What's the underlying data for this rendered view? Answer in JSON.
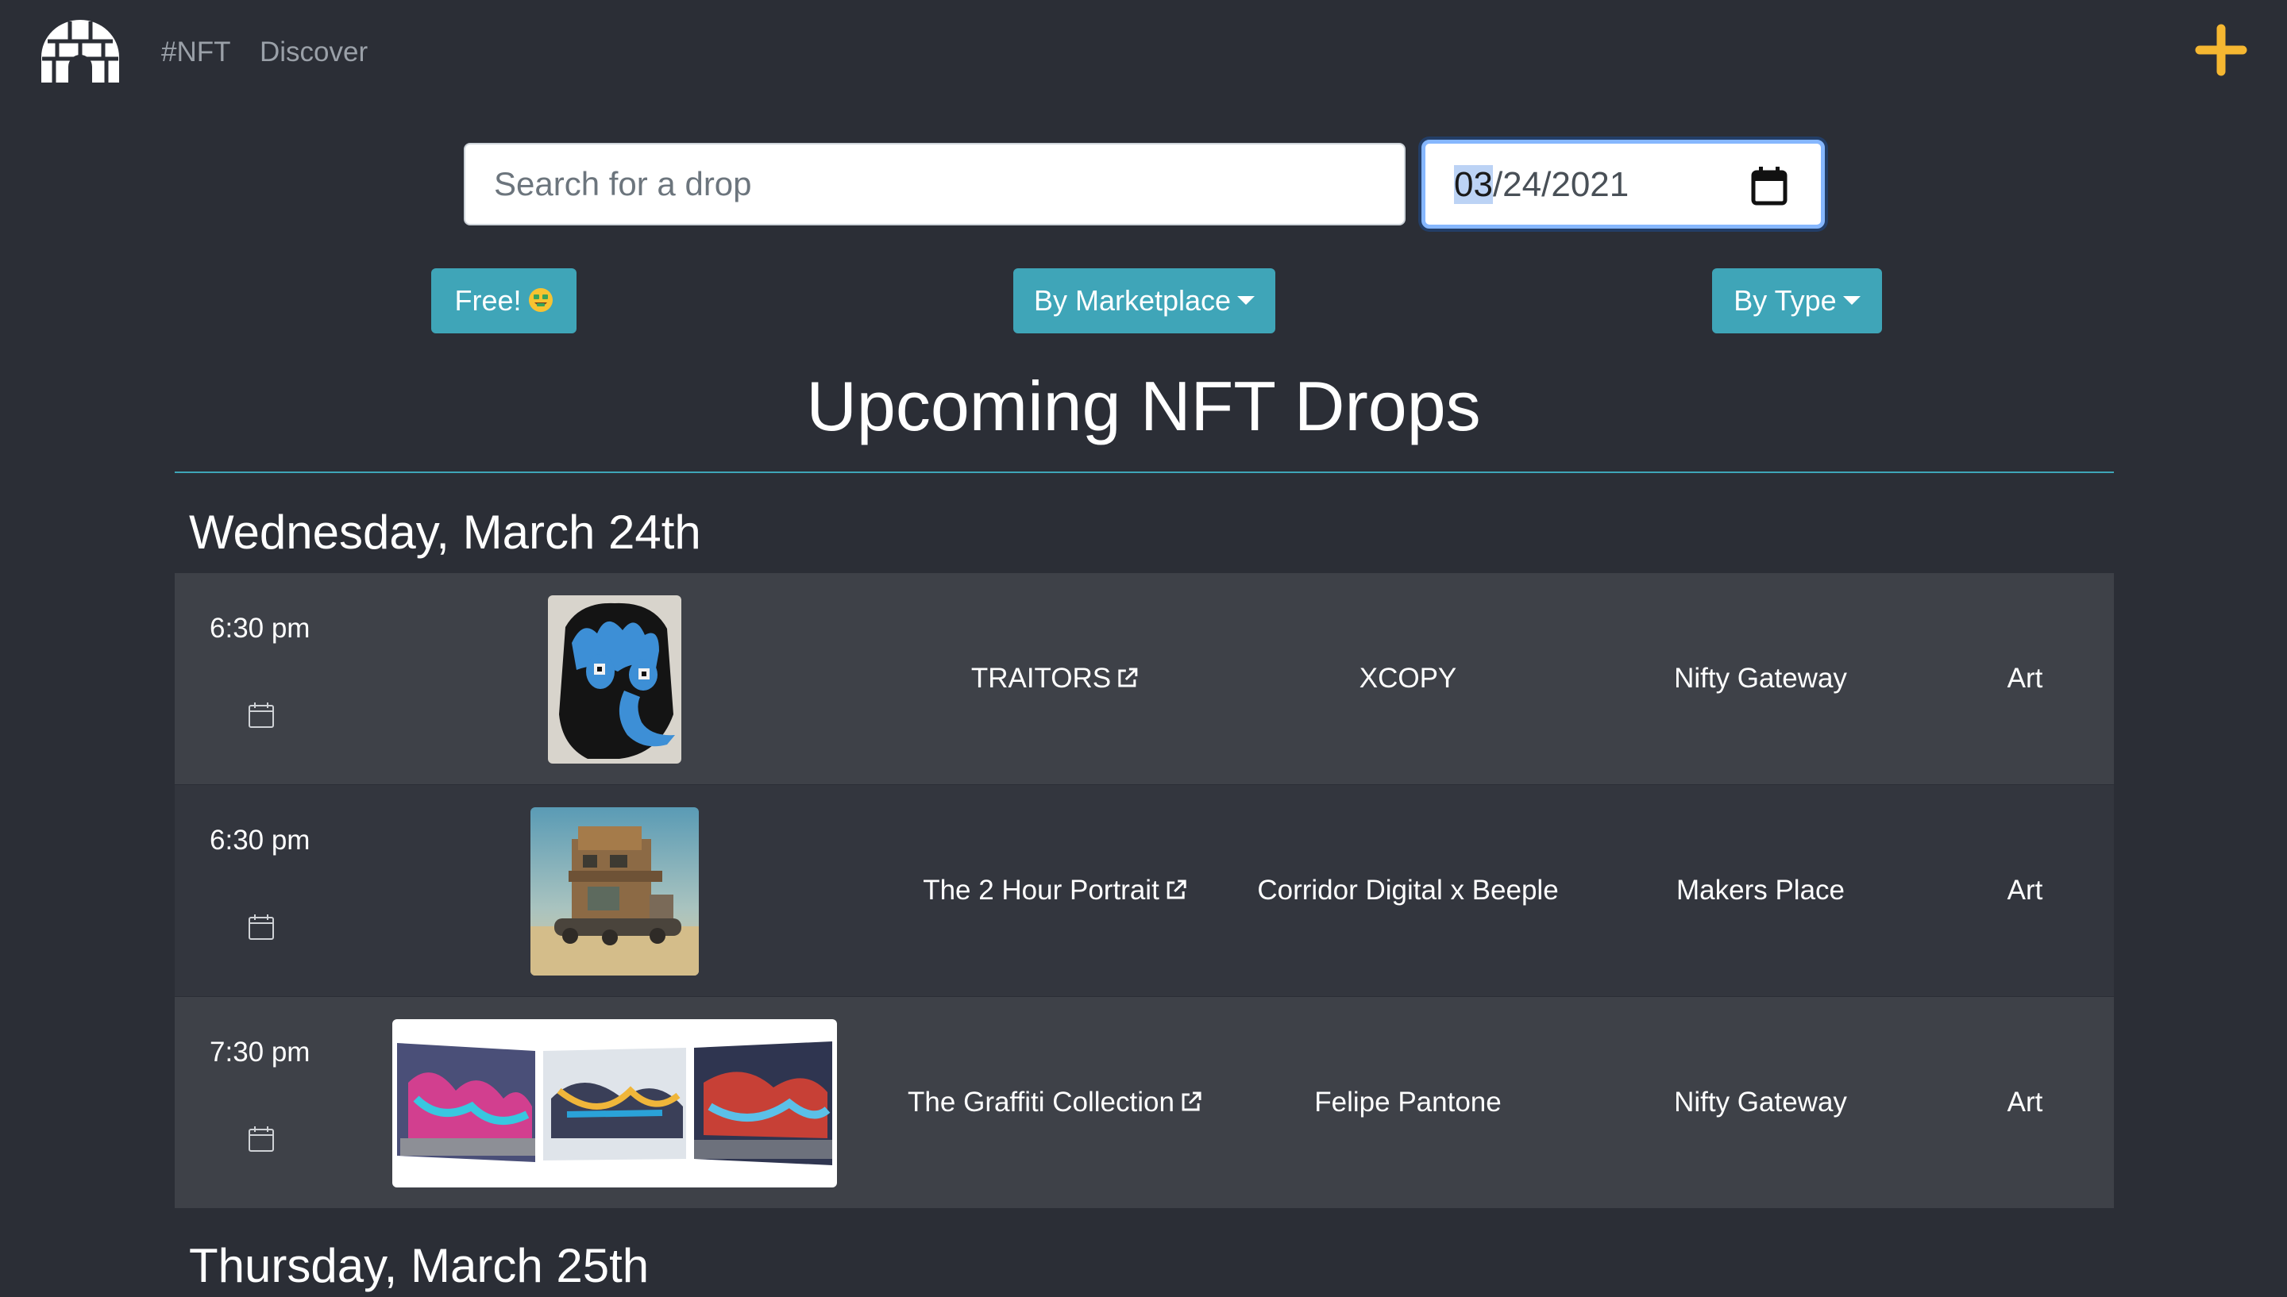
{
  "nav": {
    "logo_icon": "igloo-logo-icon",
    "links": [
      "#NFT",
      "Discover"
    ],
    "add_icon": "plus-icon",
    "accent_color": "#f5b731"
  },
  "search": {
    "placeholder": "Search for a drop",
    "value": ""
  },
  "date_picker": {
    "month": "03",
    "rest": "/24/2021",
    "icon": "calendar-picker-icon"
  },
  "filters": {
    "free_label": "Free!",
    "free_emoji": "money-mouth-face-icon",
    "marketplace_label": "By Marketplace",
    "type_label": "By Type",
    "button_color": "#3fa5b8"
  },
  "page_title": "Upcoming NFT Drops",
  "days": [
    {
      "heading": "Wednesday, March 24th",
      "drops": [
        {
          "time": "6:30 pm",
          "title": "TRAITORS",
          "artist": "XCOPY",
          "marketplace": "Nifty Gateway",
          "type": "Art"
        },
        {
          "time": "6:30 pm",
          "title": "The 2 Hour Portrait",
          "artist": "Corridor Digital x Beeple",
          "marketplace": "Makers Place",
          "type": "Art"
        },
        {
          "time": "7:30 pm",
          "title": "The Graffiti Collection",
          "artist": "Felipe Pantone",
          "marketplace": "Nifty Gateway",
          "type": "Art"
        }
      ]
    },
    {
      "heading": "Thursday, March 25th",
      "drops": []
    }
  ]
}
